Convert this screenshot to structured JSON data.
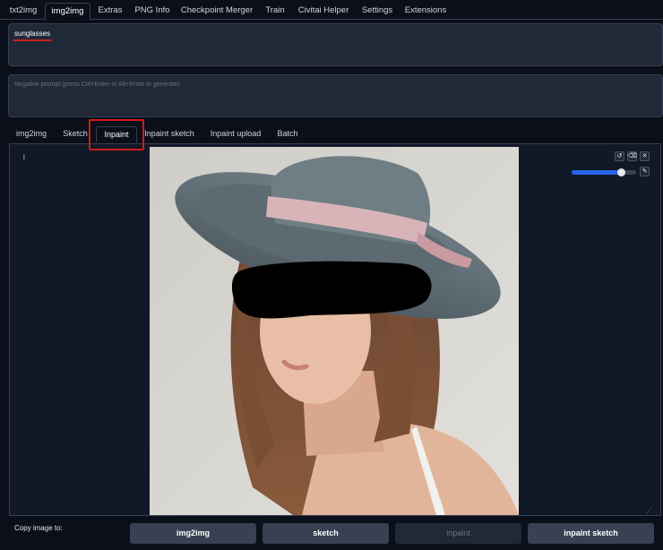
{
  "top_tabs": [
    "txt2img",
    "img2img",
    "Extras",
    "PNG Info",
    "Checkpoint Merger",
    "Train",
    "Civitai Helper",
    "Settings",
    "Extensions"
  ],
  "active_top_tab": "img2img",
  "prompt": {
    "value": "sunglasses"
  },
  "negative_prompt": {
    "placeholder": "Negative prompt (press Ctrl+Enter or Alt+Enter to generate)"
  },
  "sub_tabs": [
    "img2img",
    "Sketch",
    "Inpaint",
    "Inpaint sketch",
    "Inpaint upload",
    "Batch"
  ],
  "active_sub_tab": "Inpaint",
  "image_panel": {
    "label": "i"
  },
  "canvas_tools": {
    "undo_icon": "undo-icon",
    "clear_icon": "clear-icon",
    "close_icon": "close-icon",
    "brush_icon": "brush-icon",
    "brush_size_fraction": 0.76
  },
  "copy_to": {
    "label": "Copy image to:",
    "buttons": [
      {
        "label": "img2img",
        "enabled": true
      },
      {
        "label": "sketch",
        "enabled": true
      },
      {
        "label": "inpaint",
        "enabled": false
      },
      {
        "label": "inpaint sketch",
        "enabled": true
      }
    ]
  },
  "colors": {
    "background": "#0b0f19",
    "panel": "#111827",
    "input": "#1f2937",
    "accent": "#2563eb",
    "highlight": "#d11a1a"
  }
}
